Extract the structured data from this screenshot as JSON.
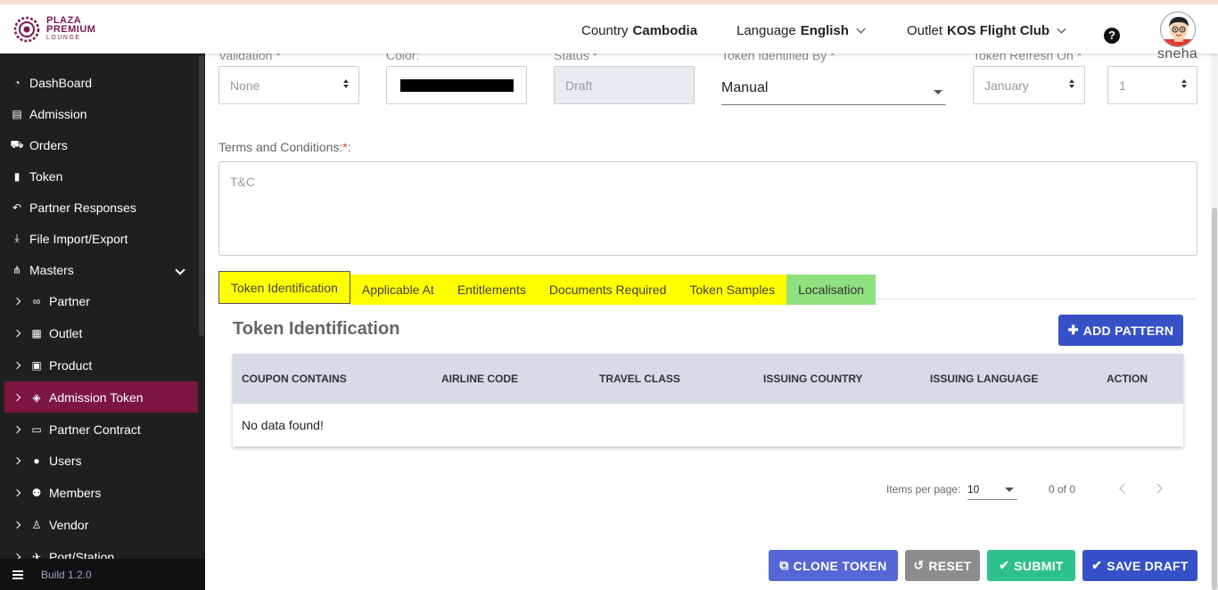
{
  "brand": {
    "line1": "PLAZA",
    "line2": "PREMIUM",
    "line3": "LOUNGE"
  },
  "header": {
    "country_label": "Country",
    "country_value": "Cambodia",
    "language_label": "Language",
    "language_value": "English",
    "outlet_label": "Outlet",
    "outlet_value": "KOS Flight Club",
    "help_icon": "question-circle-icon",
    "username": "sneha"
  },
  "sidebar": {
    "items": [
      {
        "label": "DashBoard",
        "icon": "tachometer-icon"
      },
      {
        "label": "Admission",
        "icon": "id-card-icon"
      },
      {
        "label": "Orders",
        "icon": "cart-icon"
      },
      {
        "label": "Token",
        "icon": "file-icon"
      },
      {
        "label": "Partner Responses",
        "icon": "reply-all-icon"
      },
      {
        "label": "File Import/Export",
        "icon": "download-icon"
      },
      {
        "label": "Masters",
        "icon": "sitemap-icon"
      }
    ],
    "sub_items": [
      {
        "label": "Partner",
        "icon": "handshake-icon"
      },
      {
        "label": "Outlet",
        "icon": "building-icon"
      },
      {
        "label": "Product",
        "icon": "gift-icon"
      },
      {
        "label": "Admission Token",
        "icon": "ticket-icon"
      },
      {
        "label": "Partner Contract",
        "icon": "briefcase-icon"
      },
      {
        "label": "Users",
        "icon": "user-icon"
      },
      {
        "label": "Members",
        "icon": "users-icon"
      },
      {
        "label": "Vendor",
        "icon": "male-icon"
      },
      {
        "label": "Port/Station",
        "icon": "plane-icon"
      }
    ],
    "active": "Admission Token",
    "build": "Build 1.2.0"
  },
  "form": {
    "validation_label": "Validation *",
    "validation_value": "None",
    "color_label": "Color:",
    "color_value": "#000000",
    "status_label": "Status *",
    "status_value": "Draft",
    "identified_by_label": "Token Identified By *",
    "identified_by_value": "Manual",
    "refresh_label": "Token Refresh On *",
    "refresh_month": "January",
    "refresh_day": "1",
    "tc_label": "Terms and Conditions:",
    "tc_required": "*",
    "tc_colon": ":",
    "tc_placeholder": "T&C"
  },
  "tabs": [
    {
      "label": "Token Identification",
      "color": "#ffff00",
      "active": true
    },
    {
      "label": "Applicable At",
      "color": "#ffff00"
    },
    {
      "label": "Entitlements",
      "color": "#ffff00"
    },
    {
      "label": "Documents Required",
      "color": "#ffff00"
    },
    {
      "label": "Token Samples",
      "color": "#ffff00"
    },
    {
      "label": "Localisation",
      "color": "#8fe07f"
    }
  ],
  "section": {
    "title": "Token Identification",
    "add_button": "ADD PATTERN"
  },
  "table": {
    "columns": [
      "COUPON CONTAINS",
      "AIRLINE CODE",
      "TRAVEL CLASS",
      "ISSUING COUNTRY",
      "ISSUING LANGUAGE",
      "ACTION"
    ],
    "empty_text": "No data found!"
  },
  "pagination": {
    "items_per_page_label": "Items per page:",
    "items_per_page": "10",
    "range": "0 of 0"
  },
  "actions": {
    "clone": "CLONE TOKEN",
    "reset": "RESET",
    "submit": "SUBMIT",
    "save_draft": "SAVE DRAFT"
  },
  "colors": {
    "brand": "#7b1542",
    "primary": "#3651c8",
    "success": "#2ec28a",
    "tab_yellow": "#ffff00",
    "tab_green": "#8fe07f"
  }
}
